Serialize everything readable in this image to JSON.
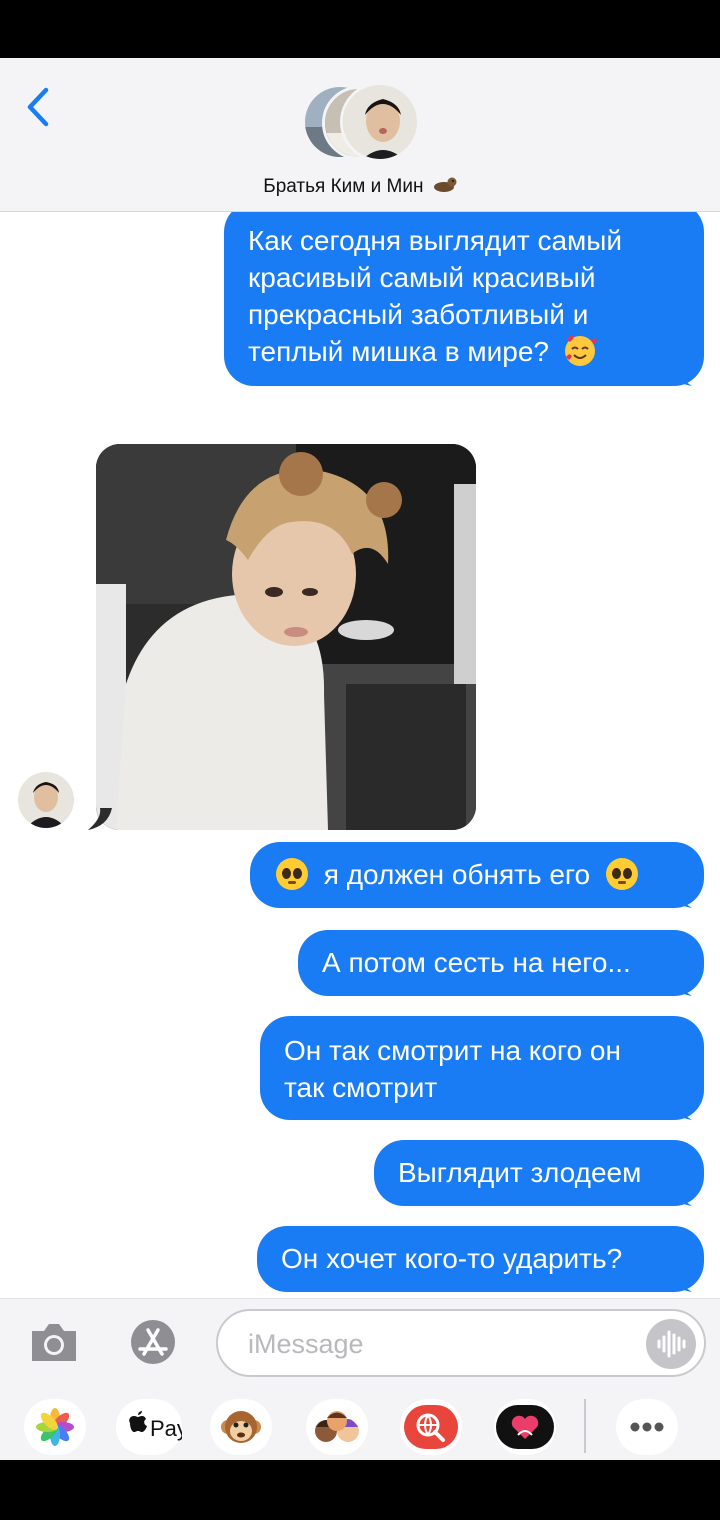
{
  "header": {
    "group_name": "Братья Ким и Мин"
  },
  "messages": {
    "m1": [
      "Как сегодня выглядит самый",
      "красивый самый красивый",
      "прекрасный заботливый и",
      "теплый мишка в мире?"
    ],
    "m2": "я должен обнять его",
    "m3": "А потом сесть на него...",
    "m4": [
      "Он так смотрит на кого он",
      "так смотрит"
    ],
    "m5": "Выглядит злодеем",
    "m6": "Он хочет кого-то ударить?"
  },
  "composer": {
    "placeholder": "iMessage"
  },
  "tray": {
    "apple_pay_label": "Pay",
    "items": [
      "photos-app-icon",
      "apple-pay-app-icon",
      "animoji-app-icon",
      "memoji-app-icon",
      "web-search-app-icon",
      "digital-touch-app-icon",
      "more-apps-icon"
    ]
  },
  "colors": {
    "bubble_blue": "#1a7cf5",
    "header_bg": "#f4f4f6",
    "accent_blue": "#1a7cf5"
  }
}
